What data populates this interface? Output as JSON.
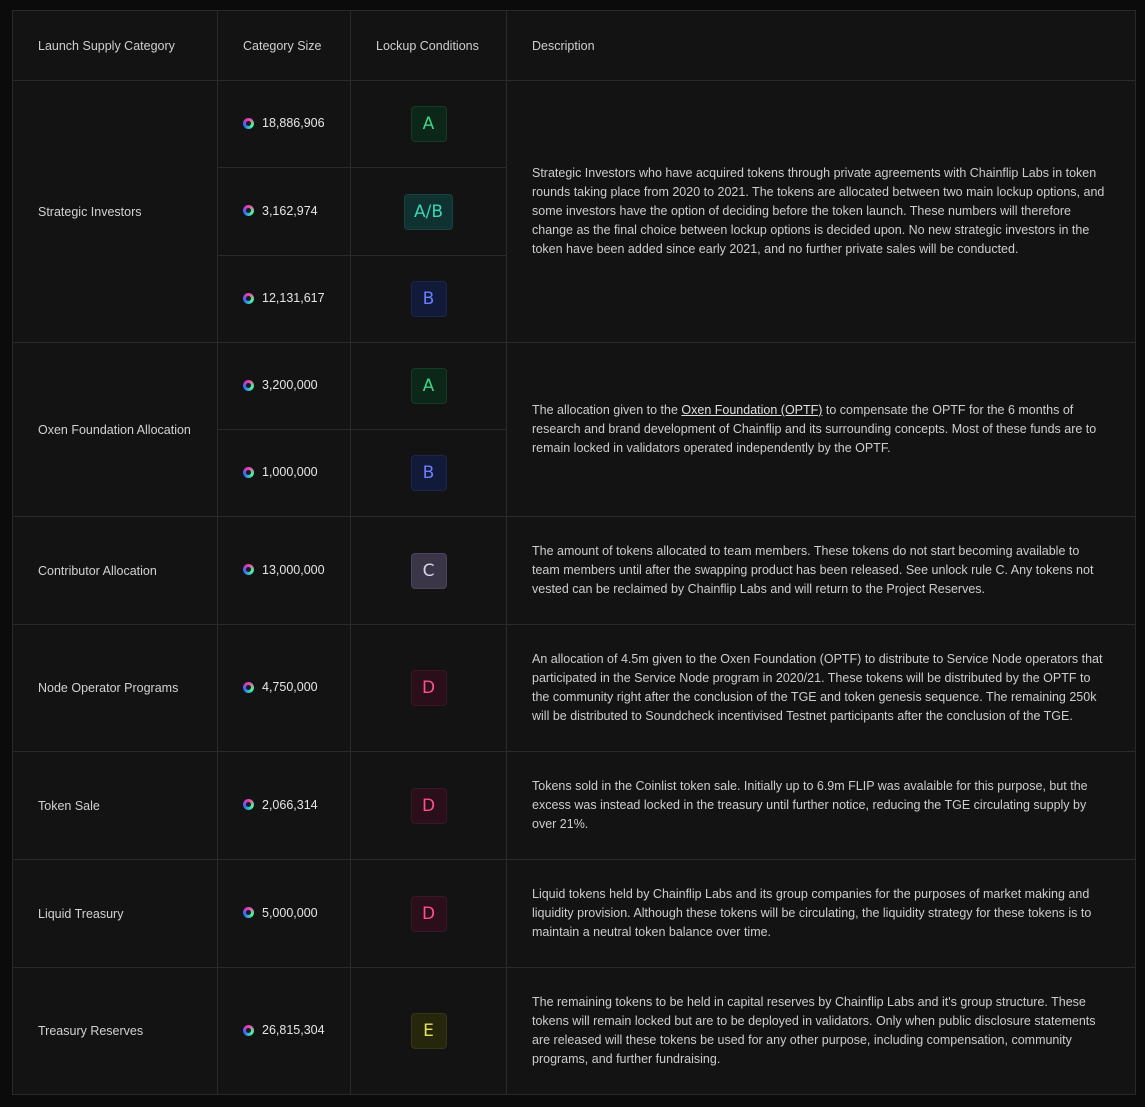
{
  "headers": {
    "category": "Launch Supply Category",
    "size": "Category Size",
    "lockup": "Lockup Conditions",
    "description": "Description"
  },
  "rows": [
    {
      "category": "Strategic Investors",
      "entries": [
        {
          "size": "18,886,906",
          "lockup": "A"
        },
        {
          "size": "3,162,974",
          "lockup": "A/B"
        },
        {
          "size": "12,131,617",
          "lockup": "B"
        }
      ],
      "description": "Strategic Investors who have acquired tokens through private agreements with Chainflip Labs in token rounds taking place from 2020 to 2021. The tokens are allocated between two main lockup options, and some investors have the option of deciding before the token launch. These numbers will therefore change as the final choice between lockup options is decided upon. No new strategic investors in the token have been added since early 2021, and no further private sales will be conducted."
    },
    {
      "category": "Oxen Foundation Allocation",
      "entries": [
        {
          "size": "3,200,000",
          "lockup": "A"
        },
        {
          "size": "1,000,000",
          "lockup": "B"
        }
      ],
      "description_pre": "The allocation given to the ",
      "description_link": "Oxen Foundation (OPTF)",
      "description_post": " to compensate the OPTF for the 6 months of research and brand development of Chainflip and its surrounding concepts. Most of these funds are to remain locked in validators operated independently by the OPTF."
    },
    {
      "category": "Contributor Allocation",
      "entries": [
        {
          "size": "13,000,000",
          "lockup": "C"
        }
      ],
      "description": "The amount of tokens allocated to team members. These tokens do not start becoming available to team members until after the swapping product has been released. See unlock rule C. Any tokens not vested can be reclaimed by Chainflip Labs and will return to the Project Reserves."
    },
    {
      "category": "Node Operator Programs",
      "entries": [
        {
          "size": "4,750,000",
          "lockup": "D"
        }
      ],
      "description": "An allocation of 4.5m given to the Oxen Foundation (OPTF) to distribute to Service Node operators that participated in the Service Node program in 2020/21. These tokens will be distributed by the OPTF to the community right after the conclusion of the TGE and token genesis sequence. The remaining 250k will be distributed to Soundcheck incentivised Testnet participants after the conclusion of the TGE."
    },
    {
      "category": "Token Sale",
      "entries": [
        {
          "size": "2,066,314",
          "lockup": "D"
        }
      ],
      "description": "Tokens sold in the Coinlist token sale. Initially up to 6.9m FLIP was avalaible for this purpose, but the excess was instead locked in the treasury until further notice, reducing the TGE circulating supply by over 21%."
    },
    {
      "category": "Liquid Treasury",
      "entries": [
        {
          "size": "5,000,000",
          "lockup": "D"
        }
      ],
      "description": "Liquid tokens held by Chainflip Labs and its group companies for the purposes of market making and liquidity provision. Although these tokens will be circulating, the liquidity strategy for these tokens is to maintain a neutral token balance over time."
    },
    {
      "category": "Treasury Reserves",
      "entries": [
        {
          "size": "26,815,304",
          "lockup": "E"
        }
      ],
      "description": "The remaining tokens to be held in capital reserves by Chainflip Labs and it's group structure. These tokens will remain locked but are to be deployed in validators. Only when public disclosure statements are released will these tokens be used for any other purpose, including compensation, community programs, and further fundraising."
    }
  ],
  "icons": {
    "token": "flip-token-icon"
  },
  "colors": {
    "A": "#40d48a",
    "A/B": "#3cd3b8",
    "B": "#6a7eff",
    "C": "#d9d2ea",
    "D": "#ff4f8e",
    "E": "#e5e35a"
  }
}
